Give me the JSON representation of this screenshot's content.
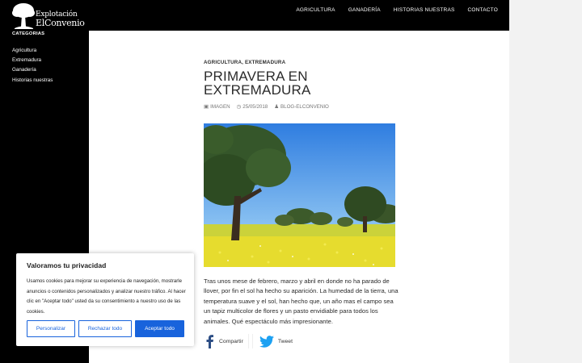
{
  "site": {
    "logo_line1": "Explotación",
    "logo_line2": "ElConvenio"
  },
  "nav": {
    "items": [
      {
        "label": "AGRICULTURA"
      },
      {
        "label": "GANADERÍA"
      },
      {
        "label": "HISTORIAS NUESTRAS"
      },
      {
        "label": "CONTACTO"
      }
    ]
  },
  "sidebar": {
    "title": "CATEGORIAS",
    "items": [
      {
        "label": "Agricultura"
      },
      {
        "label": "Extremadura"
      },
      {
        "label": "Ganadería"
      },
      {
        "label": "Historias nuestras"
      }
    ]
  },
  "post": {
    "categories": "AGRICULTURA, EXTREMADURA",
    "title": "PRIMAVERA EN EXTREMADURA",
    "meta": {
      "format": "IMAGEN",
      "date": "25/05/2018",
      "author": "BLOG-ELCONVENIO"
    },
    "body": "Tras unos mese de febrero, marzo y abril en donde no ha parado de llover, por fin el sol ha hecho su aparición. La humedad de la tierra, una temperatura suave y el sol, han hecho que, un año mas el campo sea un tapiz multicolor de flores y un pasto envidiable para todos los animales. Qué espectáculo más impresionante."
  },
  "share": {
    "facebook_label": "Compartir",
    "twitter_label": "Tweet"
  },
  "cookie": {
    "title": "Valoramos tu privacidad",
    "text": "Usamos cookies para mejorar su experiencia de navegación, mostrarle anuncios o contenidos personalizados y analizar nuestro tráfico. Al hacer clic en \"Aceptar todo\" usted da su consentimiento a nuestro uso de las cookies.",
    "customize_label": "Personalizar",
    "reject_label": "Rechazar todo",
    "accept_label": "Aceptar todo"
  },
  "colors": {
    "primary_button": "#1863dc",
    "header_bg": "#000000"
  }
}
